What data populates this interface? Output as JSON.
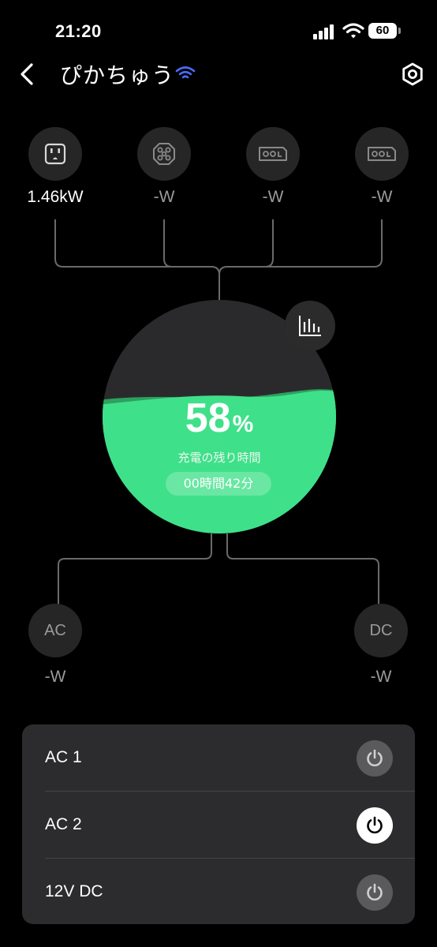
{
  "status_bar": {
    "time": "21:20",
    "battery_level": "60"
  },
  "header": {
    "title": "ぴかちゅう",
    "back_icon": "chevron-left-icon",
    "settings_icon": "hexagon-gear-icon",
    "connection_icon": "wifi-icon"
  },
  "inputs": [
    {
      "icon": "ac-outlet-icon",
      "value": "1.46kW",
      "active": true
    },
    {
      "icon": "car-port-icon",
      "value": "-W",
      "active": false
    },
    {
      "icon": "solar-port-icon",
      "value": "-W",
      "active": false
    },
    {
      "icon": "solar-port-icon",
      "value": "-W",
      "active": false
    }
  ],
  "battery": {
    "percent": "58",
    "percent_unit": "%",
    "level_fraction": 0.58,
    "charge_label": "充電の残り時間",
    "charge_time": "00時間42分"
  },
  "outputs": [
    {
      "label": "AC",
      "value": "-W"
    },
    {
      "label": "DC",
      "value": "-W"
    }
  ],
  "switches": [
    {
      "label": "AC 1",
      "state": "off"
    },
    {
      "label": "AC 2",
      "state": "on"
    },
    {
      "label": "12V DC",
      "state": "off"
    }
  ],
  "colors": {
    "accent_green": "#3fe08a",
    "background": "#000000",
    "panel": "#2c2c2e"
  }
}
